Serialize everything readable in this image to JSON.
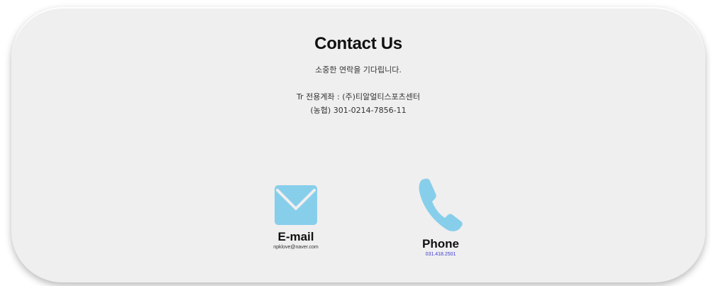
{
  "contact": {
    "title": "Contact Us",
    "subtitle": "소중한 연락을 기다립니다.",
    "account_line1": "Tr 전용계좌 : (주)티알얼티스포츠센터",
    "account_line2": "(농협) 301-0214-7856-11"
  },
  "email": {
    "icon": "envelope-icon",
    "label": "E-mail",
    "value": "npklove@naver.com"
  },
  "phone": {
    "icon": "phone-icon",
    "label": "Phone",
    "value": "031.418.2501"
  },
  "colors": {
    "card_background": "#efefef",
    "icon_blue": "#87ceeb",
    "link_blue": "#3b3bd6"
  }
}
